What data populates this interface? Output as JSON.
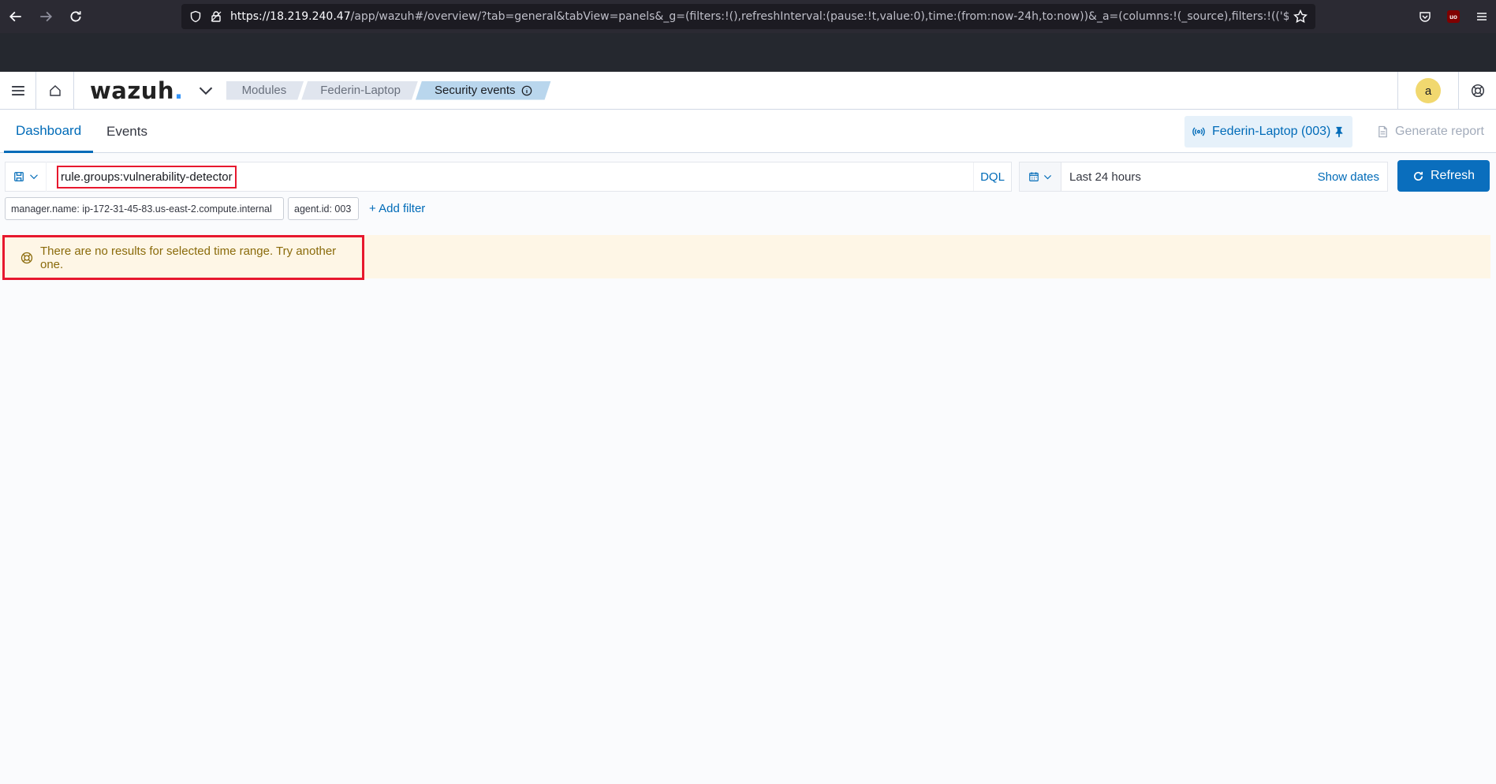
{
  "browser": {
    "url_host": "https://18.219.240.47",
    "url_rest": "/app/wazuh#/overview/?tab=general&tabView=panels&_g=(filters:!(),refreshInterval:(pause:!t,value:0),time:(from:now-24h,to:now))&_a=(columns:!(_source),filters:!(('$state':(is"
  },
  "header": {
    "logo_text": "wazuh",
    "logo_dot": ".",
    "breadcrumbs": [
      "Modules",
      "Federin-Laptop",
      "Security events"
    ],
    "avatar_letter": "a"
  },
  "tabs": [
    {
      "label": "Dashboard"
    },
    {
      "label": "Events"
    }
  ],
  "agent": {
    "label": "Federin-Laptop (003)"
  },
  "generate_report_label": "Generate report",
  "query": {
    "value": "rule.groups:vulnerability-detector",
    "language_label": "DQL"
  },
  "date": {
    "range_label": "Last 24 hours",
    "show_dates_label": "Show dates",
    "refresh_label": "Refresh"
  },
  "filters": [
    {
      "label": "manager.name: ip-172-31-45-83.us-east-2.compute.internal"
    },
    {
      "label": "agent.id: 003"
    }
  ],
  "add_filter_label": "+ Add filter",
  "callout": {
    "message": "There are no results for selected time range. Try another one."
  },
  "colors": {
    "accent": "#006bb8",
    "highlight_border": "#e7182e",
    "callout_bg": "#fef6e6"
  }
}
